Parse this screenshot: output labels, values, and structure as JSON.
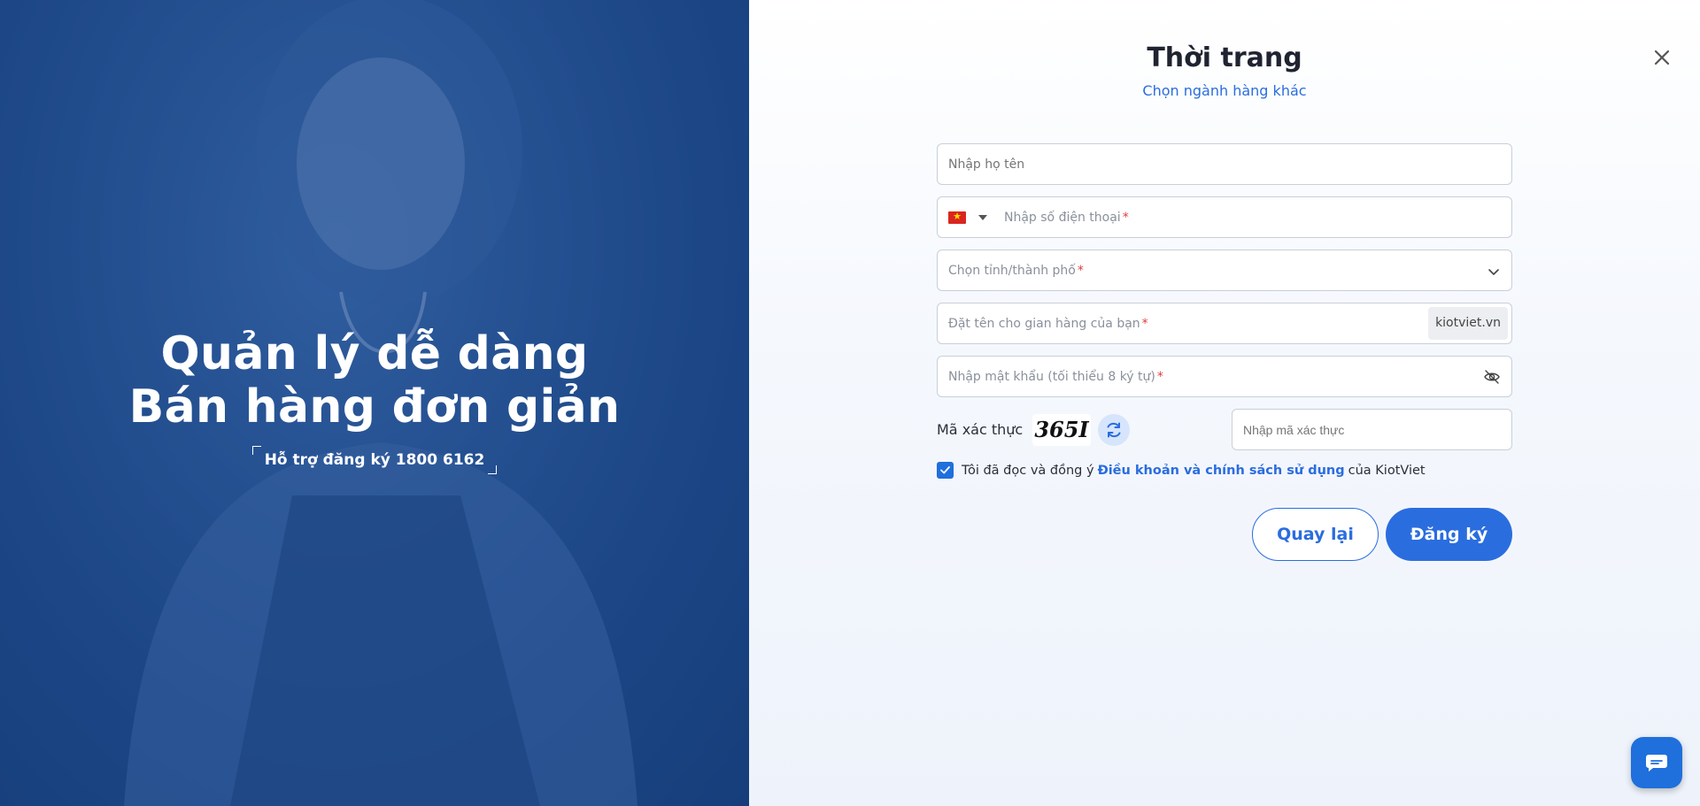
{
  "hero": {
    "title_line1": "Quản lý dễ dàng",
    "title_line2": "Bán hàng đơn giản",
    "support": "Hỗ trợ đăng ký 1800 6162"
  },
  "header": {
    "title": "Thời trang",
    "change_link": "Chọn ngành hàng khác",
    "close_icon": "close-icon"
  },
  "form": {
    "name": {
      "placeholder": "Nhập họ tên",
      "value": ""
    },
    "phone": {
      "placeholder": "Nhập số điện thoại",
      "required": "*",
      "country_flag": "vn-flag-icon"
    },
    "city": {
      "placeholder": "Chọn tỉnh/thành phố",
      "required": "*"
    },
    "shop": {
      "placeholder": "Đặt tên cho gian hàng của bạn",
      "required": "*",
      "suffix": "kiotviet.vn"
    },
    "password": {
      "placeholder": "Nhập mật khẩu (tối thiểu 8 ký tự)",
      "required": "*"
    },
    "captcha": {
      "label": "Mã xác thực",
      "code": "365I",
      "input_placeholder": "Nhập mã xác thực"
    },
    "terms": {
      "prefix": "Tôi đã đọc và đồng ý",
      "link": "Điều khoản và chính sách sử dụng",
      "suffix": "của KiotViet",
      "checked": true
    }
  },
  "actions": {
    "back": "Quay lại",
    "submit": "Đăng ký"
  },
  "colors": {
    "accent": "#2a6ddf",
    "hero_bg": "#1f4a88",
    "required": "#e23b3b"
  }
}
